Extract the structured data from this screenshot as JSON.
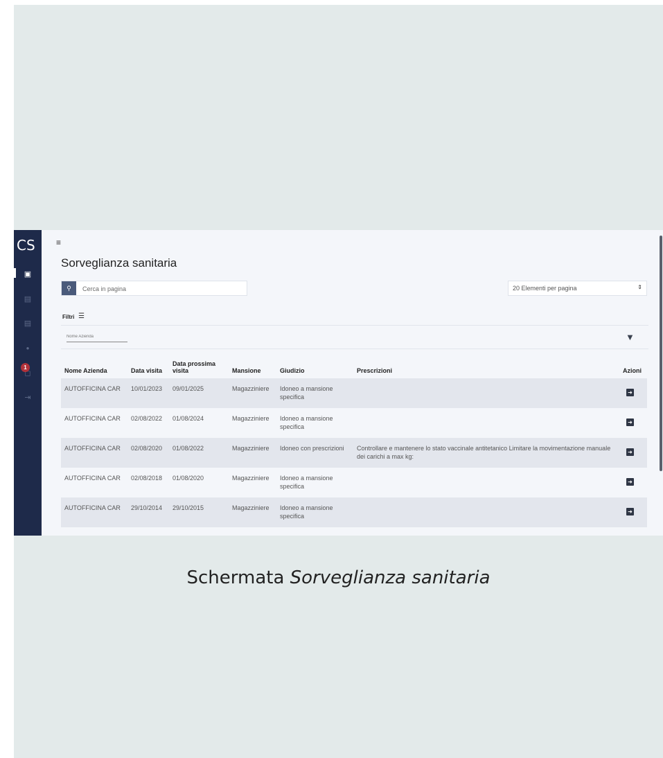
{
  "sidebar": {
    "logo": "CS",
    "icons": [
      {
        "name": "calendar-icon",
        "glyph": "▣",
        "active": true
      },
      {
        "name": "document-icon",
        "glyph": "▤",
        "active": false
      },
      {
        "name": "document-icon",
        "glyph": "▤",
        "active": false
      },
      {
        "name": "user-icon",
        "glyph": "●",
        "active": false
      },
      {
        "name": "notifications-icon",
        "glyph": "◻",
        "active": false
      },
      {
        "name": "logout-icon",
        "glyph": "⇥",
        "active": false
      }
    ],
    "notification_count": "1"
  },
  "header": {
    "menu_icon": "≡",
    "title": "Sorveglianza sanitaria"
  },
  "search": {
    "placeholder": "Cerca in pagina",
    "icon": "search-icon"
  },
  "pagination": {
    "per_page": "20 Elementi per pagina"
  },
  "filters": {
    "label": "Filtri",
    "company_placeholder": "Nome Azienda"
  },
  "table": {
    "columns": [
      "Nome Azienda",
      "Data visita",
      "Data prossima visita",
      "Mansione",
      "Giudizio",
      "Prescrizioni",
      "Azioni"
    ],
    "rows": [
      {
        "azienda": "AUTOFFICINA CAR",
        "data_visita": "10/01/2023",
        "prossima": "09/01/2025",
        "mansione": "Magazziniere",
        "giudizio": "Idoneo a mansione specifica",
        "prescrizioni": ""
      },
      {
        "azienda": "AUTOFFICINA CAR",
        "data_visita": "02/08/2022",
        "prossima": "01/08/2024",
        "mansione": "Magazziniere",
        "giudizio": "Idoneo a mansione specifica",
        "prescrizioni": ""
      },
      {
        "azienda": "AUTOFFICINA CAR",
        "data_visita": "02/08/2020",
        "prossima": "01/08/2022",
        "mansione": "Magazziniere",
        "giudizio": "Idoneo con prescrizioni",
        "prescrizioni": "Controllare e mantenere lo stato vaccinale antitetanico Limitare la movimentazione manuale dei carichi a max kg:"
      },
      {
        "azienda": "AUTOFFICINA CAR",
        "data_visita": "02/08/2018",
        "prossima": "01/08/2020",
        "mansione": "Magazziniere",
        "giudizio": "Idoneo a mansione specifica",
        "prescrizioni": ""
      },
      {
        "azienda": "AUTOFFICINA CAR",
        "data_visita": "29/10/2014",
        "prossima": "29/10/2015",
        "mansione": "Magazziniere",
        "giudizio": "Idoneo a mansione specifica",
        "prescrizioni": ""
      }
    ]
  },
  "caption": {
    "prefix": "Schermata ",
    "italic": "Sorveglianza sanitaria"
  }
}
